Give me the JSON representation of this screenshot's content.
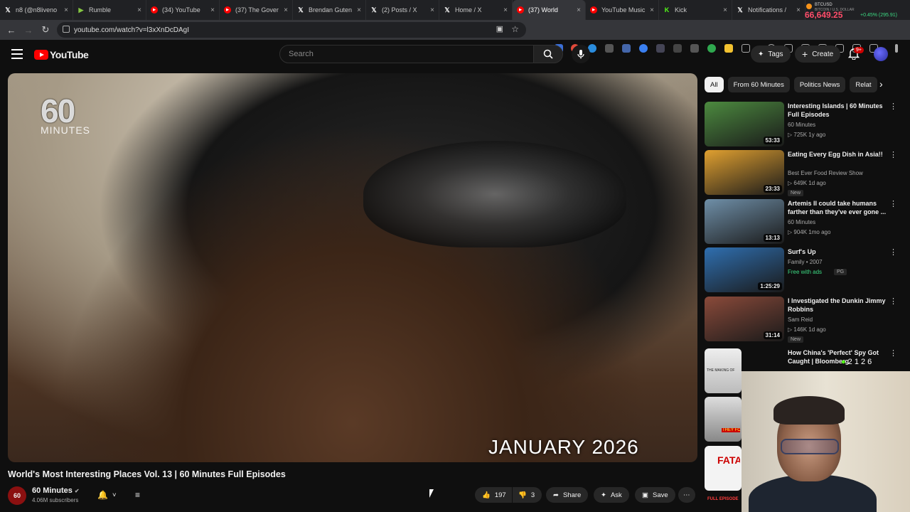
{
  "browser": {
    "tabs": [
      {
        "label": "n8 (@n8liveno",
        "icon": "x-icon",
        "color": "#ffffff"
      },
      {
        "label": "Rumble",
        "icon": "rumble-icon",
        "color": "#85c742"
      },
      {
        "label": "(34) YouTube",
        "icon": "youtube-icon",
        "color": "#ff0000"
      },
      {
        "label": "(37) The Gover",
        "icon": "youtube-icon",
        "color": "#ff0000"
      },
      {
        "label": "Brendan Guten",
        "icon": "x-icon",
        "color": "#ffffff"
      },
      {
        "label": "(2) Posts / X",
        "icon": "x-icon",
        "color": "#ffffff"
      },
      {
        "label": "Home / X",
        "icon": "x-icon",
        "color": "#ffffff"
      },
      {
        "label": "(37) World",
        "icon": "youtube-icon",
        "color": "#ff0000",
        "active": true
      },
      {
        "label": "YouTube Music",
        "icon": "youtube-music-icon",
        "color": "#ff0000"
      },
      {
        "label": "Kick",
        "icon": "kick-icon",
        "color": "#53fc18"
      },
      {
        "label": "Notifications /",
        "icon": "x-icon",
        "color": "#ffffff"
      }
    ],
    "ticker": {
      "symbol": "BTCUSD",
      "subtitle": "BITCOIN / U.S. DOLLAR",
      "price": "66,649.25",
      "change": "+0.45% (295.91)"
    },
    "url": "youtube.com/watch?v=l3xXnDcDAgI"
  },
  "header": {
    "logo_text": "YouTube",
    "search_placeholder": "Search",
    "tags_label": "Tags",
    "create_label": "Create",
    "notif_badge": "9+"
  },
  "video": {
    "brand_number": "60",
    "brand_word": "MINUTES",
    "caption": "JANUARY 2026",
    "title": "World's Most Interesting Places Vol. 13 | 60 Minutes Full Episodes",
    "channel": "60 Minutes",
    "subscribers": "4.06M subscribers",
    "likes": "197",
    "dislikes": "3",
    "share_label": "Share",
    "ask_label": "Ask",
    "save_label": "Save"
  },
  "sidebar": {
    "chips": [
      "All",
      "From 60 Minutes",
      "Politics News",
      "Relat"
    ],
    "items": [
      {
        "title": "Interesting Islands | 60 Minutes Full Episodes",
        "channel": "60 Minutes",
        "meta": "▷ 725K  1y ago",
        "duration": "53:33",
        "thumb_color": "#4c8a3f",
        "badge": ""
      },
      {
        "title": "Eating Every Egg Dish in Asia!!",
        "channel": "Best Ever Food Review Show",
        "meta": "▷ 649K  1d ago",
        "duration": "23:33",
        "thumb_color": "#e0a030",
        "badge": "New"
      },
      {
        "title": "Artemis II could take humans farther than they've ever gone ...",
        "channel": "60 Minutes",
        "meta": "▷ 904K  1mo ago",
        "duration": "13:13",
        "thumb_color": "#6f8fa8",
        "badge": ""
      },
      {
        "title": "Surf's Up",
        "channel": "Family • 2007",
        "meta": "Free with ads",
        "rating": "PG",
        "duration": "1:25:29",
        "thumb_color": "#2f6fb0",
        "badge": ""
      },
      {
        "title": "I Investigated the Dunkin Jimmy Robbins",
        "channel": "Sam Reid",
        "meta": "▷ 146K  1d ago",
        "duration": "31:14",
        "thumb_color": "#8a4a3a",
        "badge": "New"
      },
      {
        "title": "How China's 'Perfect' Spy Got Caught | Bloomberg",
        "channel": "",
        "meta": "",
        "duration": "",
        "thumb_color": "#d8d0c0",
        "badge": ""
      }
    ],
    "extra_thumb_labels": [
      "THE MAKING OF",
      "THEY FO",
      "FATA",
      "FULL EPISODE"
    ]
  },
  "overlay": {
    "emotes": "2 1  2  6"
  }
}
